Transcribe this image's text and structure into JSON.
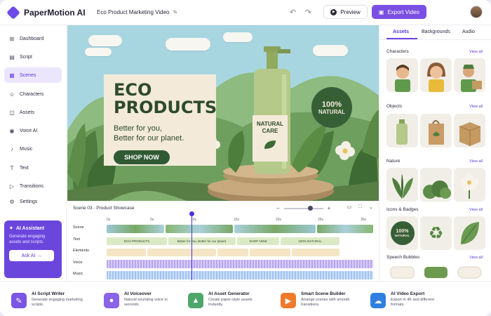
{
  "app": {
    "name": "PaperMotion AI",
    "project_title": "Eco Product Marketing Video"
  },
  "header": {
    "preview_label": "Preview",
    "export_label": "Export Video",
    "undo_icon": "undo-icon",
    "redo_icon": "redo-icon"
  },
  "sidebar": {
    "items": [
      {
        "label": "Dashboard",
        "icon": "dashboard-icon",
        "glyph": "⊞"
      },
      {
        "label": "Script",
        "icon": "script-icon",
        "glyph": "▤"
      },
      {
        "label": "Scenes",
        "icon": "scenes-icon",
        "glyph": "▦",
        "active": true
      },
      {
        "label": "Characters",
        "icon": "characters-icon",
        "glyph": "☺"
      },
      {
        "label": "Assets",
        "icon": "assets-icon",
        "glyph": "◫"
      },
      {
        "label": "Voice AI",
        "icon": "voice-icon",
        "glyph": "◉"
      },
      {
        "label": "Music",
        "icon": "music-icon",
        "glyph": "♪"
      },
      {
        "label": "Text",
        "icon": "text-icon",
        "glyph": "T"
      },
      {
        "label": "Transitions",
        "icon": "transitions-icon",
        "glyph": "▷"
      },
      {
        "label": "Settings",
        "icon": "settings-icon",
        "glyph": "⚙"
      }
    ],
    "ai_assistant": {
      "title": "AI Assistant",
      "description": "Generate engaging assets and scripts.",
      "button": "Ask AI →"
    }
  },
  "canvas": {
    "headline": "ECO PRODUCTS",
    "headline_line1": "ECO",
    "headline_line2": "PRODUCTS",
    "sub_line1": "Better for you,",
    "sub_line2": "Better for our planet.",
    "cta": "SHOP NOW",
    "badge_line1": "100%",
    "badge_line2": "NATURAL",
    "bottle_label_line1": "NATURAL",
    "bottle_label_line2": "CARE"
  },
  "timeline": {
    "title": "Scene 03 - Product Showcase",
    "tracks": [
      "Scene",
      "Text",
      "Elements",
      "Voice",
      "Music"
    ],
    "ruler": [
      "0s",
      "5s",
      "10s",
      "15s",
      "20s",
      "25s",
      "30s"
    ],
    "text_clips": [
      "ECO PRODUCTS",
      "Better for you, Better for our planet.",
      "SHOP NOW",
      "100% NATURAL"
    ],
    "zoom_out": "−",
    "zoom_in": "+"
  },
  "right_panel": {
    "tabs": [
      "Assets",
      "Backgrounds",
      "Audio"
    ],
    "active_tab": "Assets",
    "view_all": "View all",
    "sections": [
      "Characters",
      "Objects",
      "Nature",
      "Icons & Badges",
      "Speech Bubbles"
    ],
    "badge_text_1": "100%",
    "badge_text_2": "NATURAL"
  },
  "features": [
    {
      "title": "AI Script Writer",
      "desc": "Generate engaging marketing scripts.",
      "icon": "script-writer-icon",
      "color": "#7b55e4",
      "glyph": "✎"
    },
    {
      "title": "AI Voiceover",
      "desc": "Natural sounding voice in seconds.",
      "icon": "microphone-icon",
      "color": "#8a63e8",
      "glyph": "🎤"
    },
    {
      "title": "AI Asset Generator",
      "desc": "Create paper-style assets instantly.",
      "icon": "image-icon",
      "color": "#4fa66b",
      "glyph": "▲"
    },
    {
      "title": "Smart Scene Builder",
      "desc": "Arrange scenes with smooth transitions.",
      "icon": "clapper-icon",
      "color": "#ef7a2b",
      "glyph": "▶"
    },
    {
      "title": "AI Video Export",
      "desc": "Export in 4K and different formats.",
      "icon": "cloud-upload-icon",
      "color": "#2f7fe0",
      "glyph": "☁"
    }
  ]
}
